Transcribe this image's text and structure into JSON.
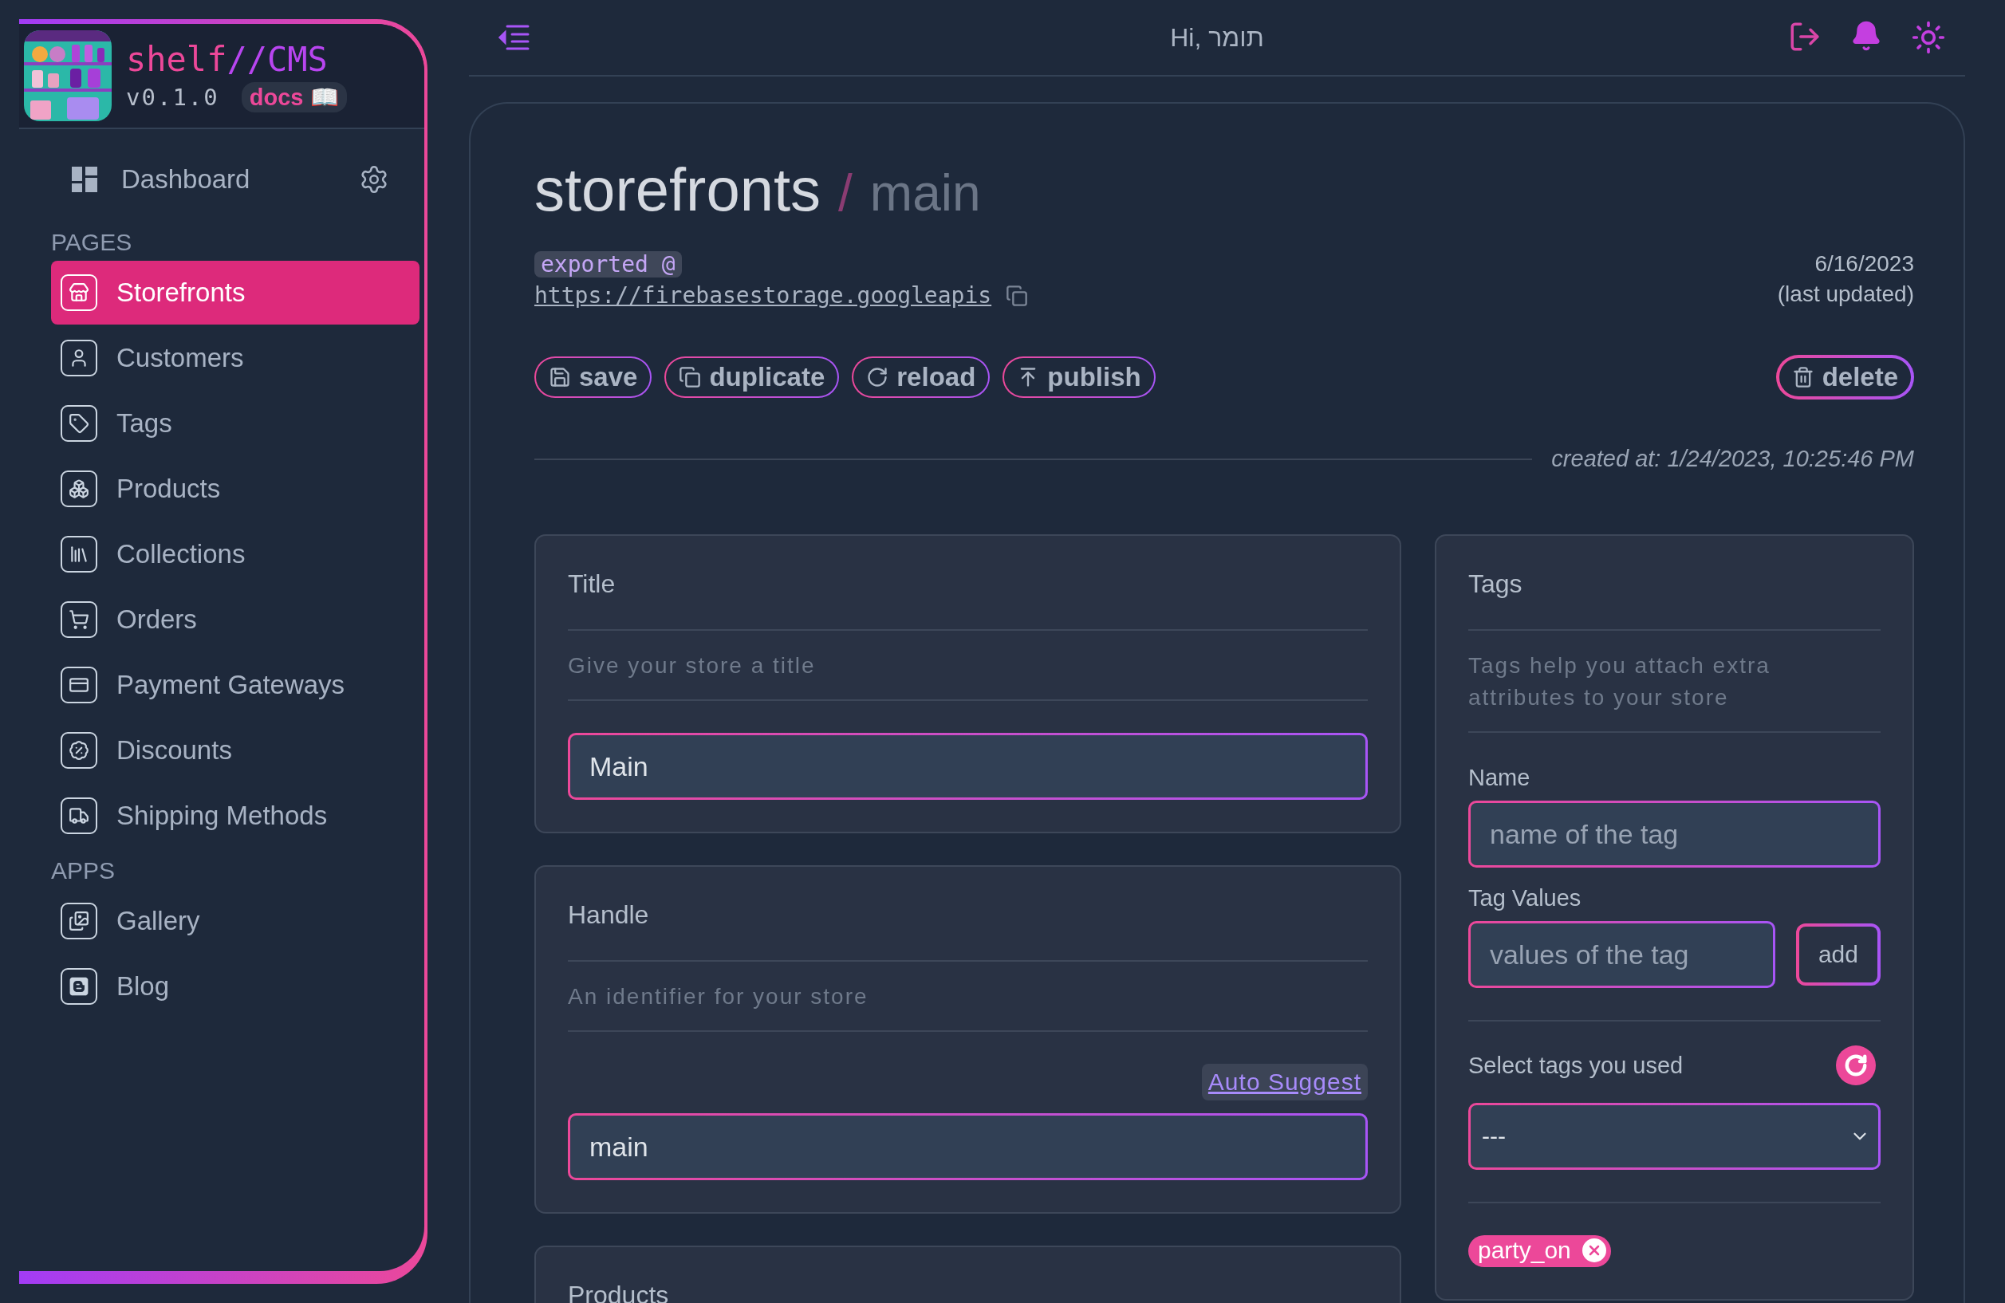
{
  "sidebar": {
    "brand": {
      "name_start": "shelf",
      "name_end": "//CMS",
      "version": "v0.1.0",
      "docs": "docs 📖"
    },
    "dashboard": {
      "label": "Dashboard"
    },
    "sections": [
      {
        "heading": "PAGES",
        "items": [
          {
            "label": "Storefronts",
            "kind": "store",
            "selected": true
          },
          {
            "label": "Customers",
            "kind": "user",
            "selected": false
          },
          {
            "label": "Tags",
            "kind": "tag",
            "selected": false
          },
          {
            "label": "Products",
            "kind": "products",
            "selected": false
          },
          {
            "label": "Collections",
            "kind": "collections",
            "selected": false
          },
          {
            "label": "Orders",
            "kind": "cart",
            "selected": false
          },
          {
            "label": "Payment Gateways",
            "kind": "card",
            "selected": false
          },
          {
            "label": "Discounts",
            "kind": "discount",
            "selected": false
          },
          {
            "label": "Shipping Methods",
            "kind": "truck",
            "selected": false
          }
        ]
      },
      {
        "heading": "APPS",
        "items": [
          {
            "label": "Gallery",
            "kind": "gallery",
            "selected": false
          },
          {
            "label": "Blog",
            "kind": "blog",
            "selected": false
          }
        ]
      }
    ]
  },
  "header": {
    "greeting": "Hi, תומר"
  },
  "page": {
    "title": "storefronts",
    "separator": "/",
    "subtitle": "main",
    "exported_label": "exported @",
    "export_url": "https://firebasestorage.googleapis",
    "updated_date": "6/16/2023",
    "updated_label": "(last updated)",
    "actions": [
      {
        "label": "save",
        "kind": "save"
      },
      {
        "label": "duplicate",
        "kind": "duplicate"
      },
      {
        "label": "reload",
        "kind": "reload"
      },
      {
        "label": "publish",
        "kind": "publish"
      }
    ],
    "delete": "delete",
    "created": "created at: 1/24/2023, 10:25:46 PM"
  },
  "title_card": {
    "title": "Title",
    "description": "Give your store a title",
    "value": "Main"
  },
  "handle_card": {
    "title": "Handle",
    "description": "An identifier for your store",
    "auto_suggest": "Auto Suggest",
    "value": "main"
  },
  "products_card": {
    "title": "Products"
  },
  "tags_card": {
    "title": "Tags",
    "description": "Tags help you attach extra attributes to your store",
    "name_label": "Name",
    "name_placeholder": "name of the tag",
    "values_label": "Tag Values",
    "values_placeholder": "values of the tag",
    "add": "add",
    "select_label": "Select tags you used",
    "select_value": "---",
    "tags": [
      {
        "label": "party_on"
      }
    ]
  }
}
